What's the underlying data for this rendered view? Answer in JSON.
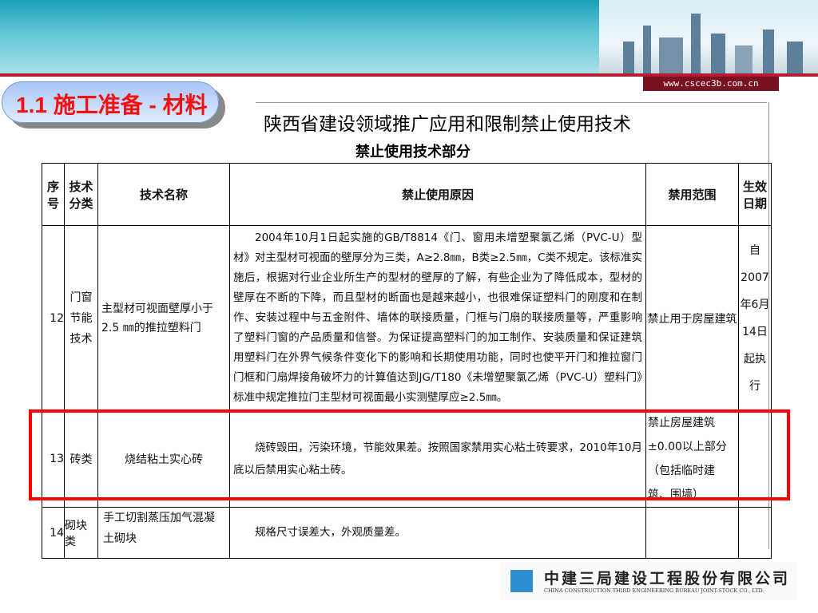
{
  "header": {
    "url": "www.cscec3b.com.cn",
    "section_title": "1.1  施工准备 - 材料"
  },
  "document": {
    "title": "陕西省建设领域推广应用和限制禁止使用技术",
    "subtitle": "禁止使用技术部分",
    "columns": [
      "序号",
      "技术分类",
      "技术名称",
      "禁止使用原因",
      "禁用范围",
      "生效日期"
    ],
    "rows": [
      {
        "no": "12",
        "category": "门窗节能技术",
        "name": "主型材可视面壁厚小于 2.5 ㎜的推拉塑料门",
        "reason": "2004年10月1日起实施的GB/T8814《门、窗用未增塑聚氯乙烯（PVC-U）型材》对主型材可视面的壁厚分为三类，A≥2.8㎜，B类≥2.5㎜，C类不规定。该标准实施后，根据对行业企业所生产的型材的壁厚的了解，有些企业为了降低成本，型材的壁厚在不断的下降，而且型材的断面也是越来越小，也很难保证塑料门的刚度和在制作、安装过程中与五金附件、墙体的联接质量，门框与门扇的联接质量等，严重影响了塑料门窗的产品质量和信誉。为保证提高塑料门的加工制作、安装质量和保证建筑用塑料门在外界气候条件变化下的影响和长期使用功能，同时也使平开门和推拉窗门门框和门扇焊接角破坏力的计算值达到JG/T180《未增塑聚氯乙烯（PVC-U）塑料门》标准中规定推拉门主型材可视面最小实测壁厚应≥2.5㎜。",
        "scope": "禁止用于房屋建筑",
        "date": "自2007年6月14日起执行"
      },
      {
        "no": "13",
        "category": "砖类",
        "name": "烧结粘土实心砖",
        "reason": "烧砖毁田，污染环境，节能效果差。按照国家禁用实心粘土砖要求，2010年10月底以后禁用实心粘土砖。",
        "scope": "禁止房屋建筑±0.00以上部分（包括临时建筑、围墙）",
        "date": ""
      },
      {
        "no": "14",
        "category": "砌块类",
        "name": "手工切割蒸压加气混凝土砌块",
        "reason": "规格尺寸误差大，外观质量差。",
        "scope": "",
        "date": ""
      }
    ]
  },
  "footer": {
    "company_cn": "中建三局建设工程股份有限公司",
    "company_en": "CHINA CONSTRUCTION THIRD ENGINEERING BUREAU JOINT-STOCK CO., LTD."
  },
  "colors": {
    "highlight": "#ff0000",
    "title": "#f21010"
  }
}
